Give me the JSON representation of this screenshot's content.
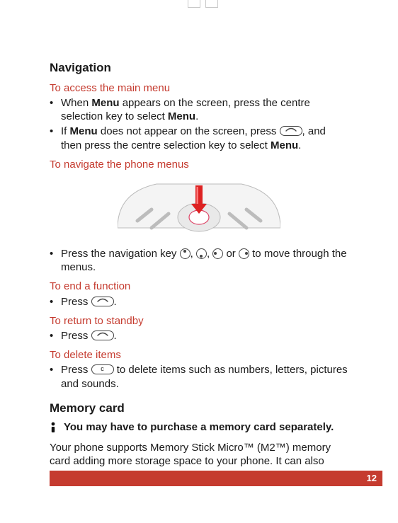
{
  "headings": {
    "navigation": "Navigation",
    "memory_card": "Memory card"
  },
  "subheads": {
    "access_main": "To access the main menu",
    "navigate_menus": "To navigate the phone menus",
    "end_function": "To end a function",
    "return_standby": "To return to standby",
    "delete_items": "To delete items"
  },
  "text": {
    "access_b1_pre": "When ",
    "access_b1_bold": "Menu",
    "access_b1_post": " appears on the screen, press the centre selection key to select ",
    "access_b1_bold2": "Menu",
    "access_b1_end": ".",
    "access_b2_pre": "If ",
    "access_b2_bold": "Menu",
    "access_b2_mid": " does not appear on the screen, press ",
    "access_b2_post": ", and then press the centre selection key to select ",
    "access_b2_bold2": "Menu",
    "access_b2_end": ".",
    "nav_bullet_pre": "Press the navigation key ",
    "nav_bullet_mid1": ", ",
    "nav_bullet_mid2": ", ",
    "nav_bullet_mid3": " or ",
    "nav_bullet_post": " to move through the menus.",
    "end_bullet": "Press ",
    "end_bullet_end": ".",
    "standby_bullet": "Press ",
    "standby_bullet_end": ".",
    "delete_bullet_pre": "Press ",
    "delete_bullet_post": " to delete items such as numbers, letters, pictures and sounds.",
    "mem_note": "You may have to purchase a memory card separately.",
    "mem_body": "Your phone supports Memory Stick Micro™ (M2™) memory card adding more storage space to your phone. It can also"
  },
  "keys": {
    "end_call_aria": "end-call key",
    "c_key": "c",
    "c_key_aria": "C key"
  },
  "page_number": "12"
}
